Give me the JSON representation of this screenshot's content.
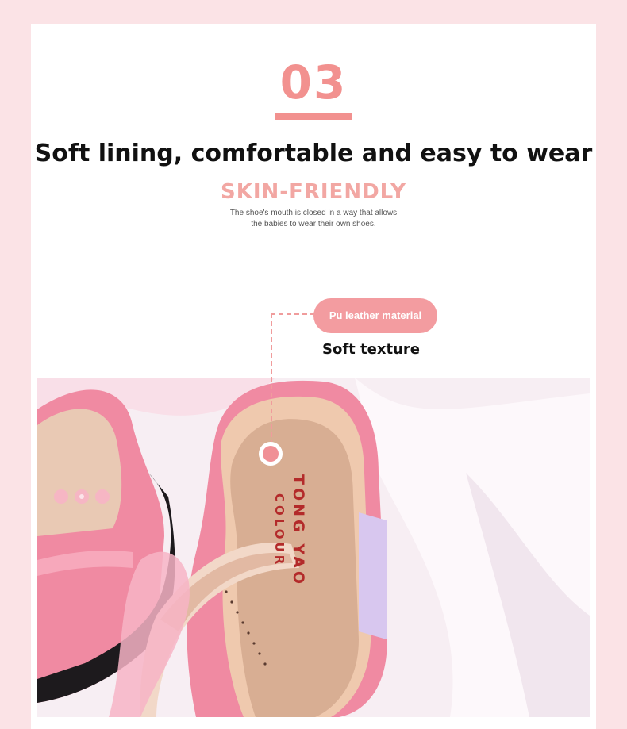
{
  "section": {
    "number": "03",
    "headline": "Soft lining, comfortable and easy to wear",
    "subheadline": "SKIN-FRIENDLY",
    "description_line1": "The shoe's mouth is closed in a way that allows",
    "description_line2": "the babies to wear their own shoes."
  },
  "callout": {
    "label": "Pu leather material",
    "caption": "Soft texture"
  },
  "photo": {
    "insole_brand_line1": "TONG YAO",
    "insole_brand_line2": "COLOUR"
  },
  "colors": {
    "accent": "#f2918f",
    "pill": "#f39ca0",
    "page_background": "#fbe3e6",
    "shoe_pink": "#f28ea6",
    "insole": "#d9b49a"
  }
}
